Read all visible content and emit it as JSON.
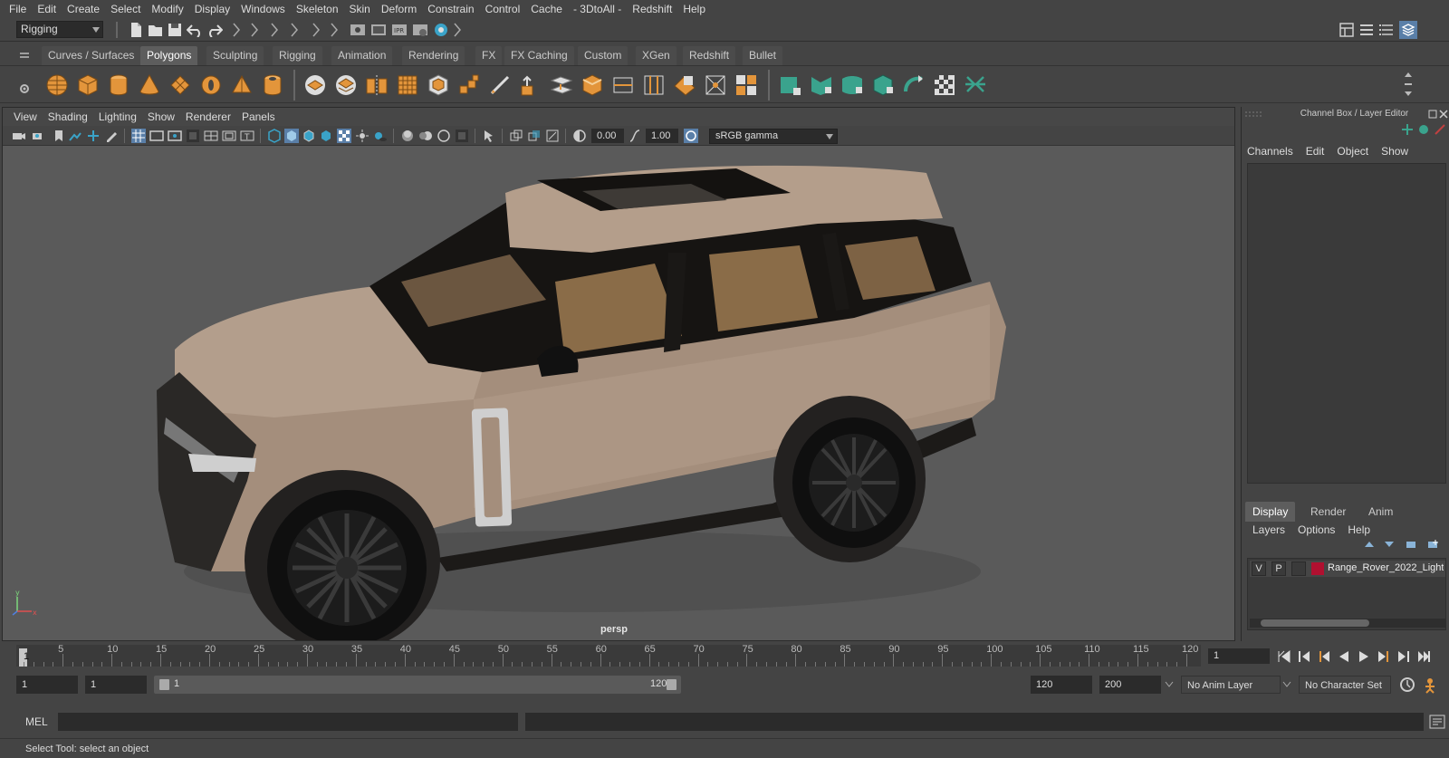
{
  "menubar": [
    "File",
    "Edit",
    "Create",
    "Select",
    "Modify",
    "Display",
    "Windows",
    "Skeleton",
    "Skin",
    "Deform",
    "Constrain",
    "Control",
    "Cache",
    "- 3DtoAll -",
    "Redshift",
    "Help"
  ],
  "mode_selector": "Rigging",
  "shelf_tabs": [
    "Curves / Surfaces",
    "Polygons",
    "Sculpting",
    "Rigging",
    "Animation",
    "Rendering",
    "FX",
    "FX Caching",
    "Custom",
    "XGen",
    "Redshift",
    "Bullet"
  ],
  "active_shelf_tab": "Polygons",
  "viewport": {
    "menu": [
      "View",
      "Shading",
      "Lighting",
      "Show",
      "Renderer",
      "Panels"
    ],
    "exposure": "0.00",
    "gamma_value": "1.00",
    "color_space": "sRGB gamma",
    "camera_label": "persp"
  },
  "channel_box": {
    "title": "Channel Box / Layer Editor",
    "menu": [
      "Channels",
      "Edit",
      "Object",
      "Show"
    ]
  },
  "layer_editor": {
    "tabs": [
      "Display",
      "Render",
      "Anim"
    ],
    "active_tab": "Display",
    "menu": [
      "Layers",
      "Options",
      "Help"
    ],
    "layers": [
      {
        "visible": "V",
        "playback": "P",
        "color": "#b01030",
        "name": "Range_Rover_2022_Light"
      }
    ]
  },
  "timeline": {
    "labels": [
      "5",
      "10",
      "15",
      "20",
      "25",
      "30",
      "35",
      "40",
      "45",
      "50",
      "55",
      "60",
      "65",
      "70",
      "75",
      "80",
      "85",
      "90",
      "95",
      "100",
      "105",
      "110",
      "115",
      "120"
    ],
    "current_frame_label": "1",
    "current_frame_input": "1"
  },
  "range": {
    "start": "1",
    "playback_start": "1",
    "slider_start": "1",
    "slider_end": "120",
    "playback_end": "120",
    "end": "200",
    "anim_layer": "No Anim Layer",
    "character_set": "No Character Set"
  },
  "command_line": {
    "label": "MEL"
  },
  "status_text": "Select Tool: select an object",
  "colors": {
    "car_body": "#a48e7c",
    "accent_orange": "#e3953b",
    "accent_teal": "#3aa38d",
    "layer_color": "#b01030"
  }
}
